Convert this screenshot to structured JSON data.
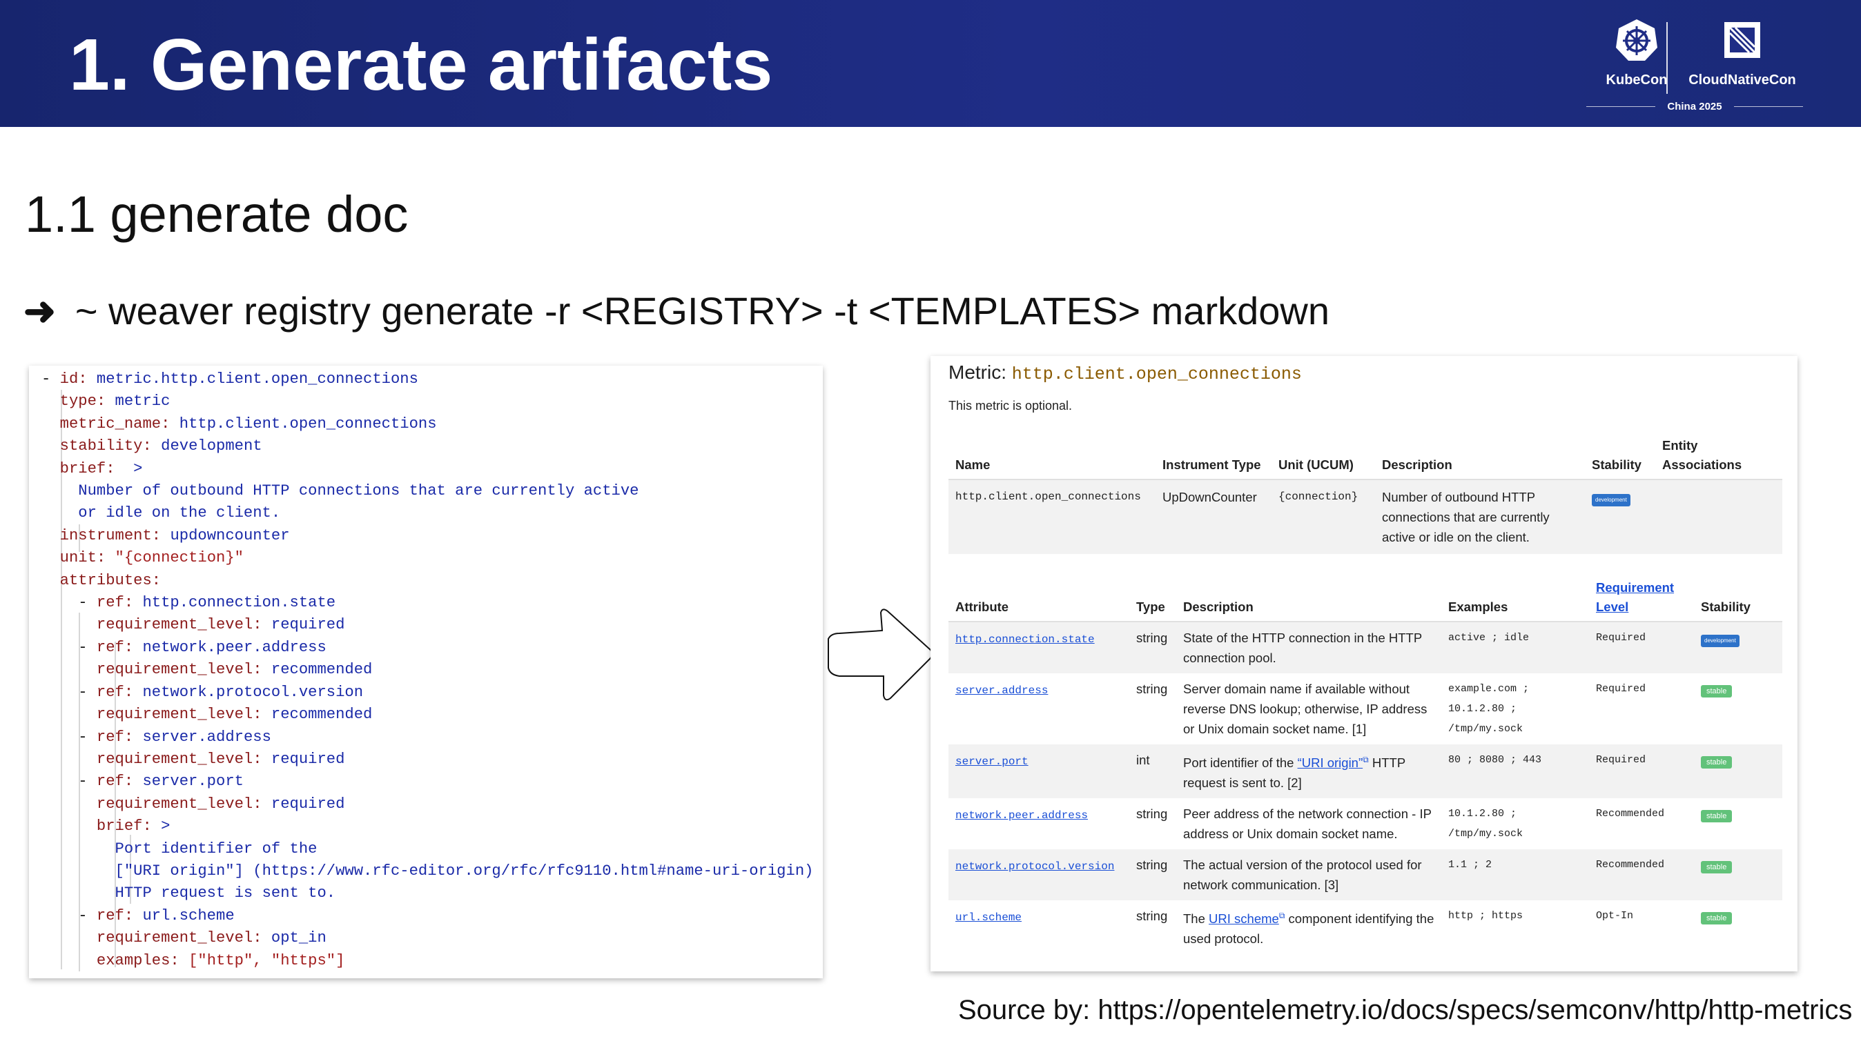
{
  "header": {
    "title": "1. Generate artifacts",
    "logo_kubecon": "KubeCon",
    "logo_cncf": "CloudNativeCon",
    "logo_event": "China 2025"
  },
  "subtitle": "1.1 generate doc",
  "command": {
    "arrow": "➜",
    "text": "~ weaver registry generate -r <REGISTRY> -t <TEMPLATES> markdown"
  },
  "yaml": {
    "lines": [
      {
        "indent": "- ",
        "key": "id",
        "value": "metric.http.client.open_connections",
        "vclass": "v"
      },
      {
        "indent": "  ",
        "key": "type",
        "value": "metric",
        "vclass": "v"
      },
      {
        "indent": "  ",
        "key": "metric_name",
        "value": "http.client.open_connections",
        "vclass": "v"
      },
      {
        "indent": "  ",
        "key": "stability",
        "value": "development",
        "vclass": "v"
      },
      {
        "indent": "  ",
        "key": "brief",
        "value": " >",
        "vclass": "v"
      },
      {
        "indent": "    ",
        "key": "",
        "value": "Number of outbound HTTP connections that are currently active",
        "vclass": "v"
      },
      {
        "indent": "    ",
        "key": "",
        "value": "or idle on the client.",
        "vclass": "v"
      },
      {
        "indent": "  ",
        "key": "instrument",
        "value": "updowncounter",
        "vclass": "v"
      },
      {
        "indent": "  ",
        "key": "unit",
        "value": "\"{connection}\"",
        "vclass": "s"
      },
      {
        "indent": "  ",
        "key": "attributes",
        "value": "",
        "vclass": "v"
      },
      {
        "indent": "    - ",
        "key": "ref",
        "value": "http.connection.state",
        "vclass": "v"
      },
      {
        "indent": "      ",
        "key": "requirement_level",
        "value": "required",
        "vclass": "v"
      },
      {
        "indent": "    - ",
        "key": "ref",
        "value": "network.peer.address",
        "vclass": "v"
      },
      {
        "indent": "      ",
        "key": "requirement_level",
        "value": "recommended",
        "vclass": "v"
      },
      {
        "indent": "    - ",
        "key": "ref",
        "value": "network.protocol.version",
        "vclass": "v"
      },
      {
        "indent": "      ",
        "key": "requirement_level",
        "value": "recommended",
        "vclass": "v"
      },
      {
        "indent": "    - ",
        "key": "ref",
        "value": "server.address",
        "vclass": "v"
      },
      {
        "indent": "      ",
        "key": "requirement_level",
        "value": "required",
        "vclass": "v"
      },
      {
        "indent": "    - ",
        "key": "ref",
        "value": "server.port",
        "vclass": "v"
      },
      {
        "indent": "      ",
        "key": "requirement_level",
        "value": "required",
        "vclass": "v"
      },
      {
        "indent": "      ",
        "key": "brief",
        "value": ">",
        "vclass": "v"
      },
      {
        "indent": "        ",
        "key": "",
        "value": "Port identifier of the",
        "vclass": "v"
      },
      {
        "indent": "        ",
        "key": "",
        "value": "[\"URI origin\"] (https://www.rfc-editor.org/rfc/rfc9110.html#name-uri-origin)",
        "vclass": "v"
      },
      {
        "indent": "        ",
        "key": "",
        "value": "HTTP request is sent to.",
        "vclass": "v"
      },
      {
        "indent": "    - ",
        "key": "ref",
        "value": "url.scheme",
        "vclass": "v"
      },
      {
        "indent": "      ",
        "key": "requirement_level",
        "value": "opt_in",
        "vclass": "v"
      },
      {
        "indent": "      ",
        "key": "examples",
        "value": "[\"http\", \"https\"]",
        "vclass": "s"
      }
    ]
  },
  "doc": {
    "metric_label": "Metric:",
    "metric_name": "http.client.open_connections",
    "optional_note": "This metric is optional.",
    "metric_table": {
      "headers": [
        "Name",
        "Instrument Type",
        "Unit (UCUM)",
        "Description",
        "Stability",
        "Entity Associations"
      ],
      "row": {
        "name": "http.client.open_connections",
        "type": "UpDownCounter",
        "unit": "{connection}",
        "description": "Number of outbound HTTP connections that are currently active or idle on the client.",
        "stability": "development",
        "entity": ""
      }
    },
    "attr_table": {
      "headers": [
        "Attribute",
        "Type",
        "Description",
        "Examples",
        "Requirement Level",
        "Stability"
      ],
      "rows": [
        {
          "attribute": "http.connection.state",
          "type": "string",
          "description": "State of the HTTP connection in the HTTP connection pool.",
          "desc_link": "",
          "desc_after": "",
          "examples": "active ; idle",
          "requirement": "Required",
          "stability": "development"
        },
        {
          "attribute": "server.address",
          "type": "string",
          "description": "Server domain name if available without reverse DNS lookup; otherwise, IP address or Unix domain socket name. [1]",
          "desc_link": "",
          "desc_after": "",
          "examples": "example.com ; 10.1.2.80 ; /tmp/my.sock",
          "requirement": "Required",
          "stability": "stable"
        },
        {
          "attribute": "server.port",
          "type": "int",
          "description": "Port identifier of the ",
          "desc_link": "“URI origin”",
          "desc_after": " HTTP request is sent to. [2]",
          "examples": "80 ; 8080 ; 443",
          "requirement": "Required",
          "stability": "stable"
        },
        {
          "attribute": "network.peer.address",
          "type": "string",
          "description": "Peer address of the network connection - IP address or Unix domain socket name.",
          "desc_link": "",
          "desc_after": "",
          "examples": "10.1.2.80 ; /tmp/my.sock",
          "requirement": "Recommended",
          "stability": "stable"
        },
        {
          "attribute": "network.protocol.version",
          "type": "string",
          "description": "The actual version of the protocol used for network communication. [3]",
          "desc_link": "",
          "desc_after": "",
          "examples": "1.1 ; 2",
          "requirement": "Recommended",
          "stability": "stable"
        },
        {
          "attribute": "url.scheme",
          "type": "string",
          "description": "The ",
          "desc_link": "URI scheme",
          "desc_after": " component identifying the used protocol.",
          "examples": "http ; https",
          "requirement": "Opt-In",
          "stability": "stable"
        }
      ]
    }
  },
  "source": "Source by: https://opentelemetry.io/docs/specs/semconv/http/http-metrics",
  "colors": {
    "header_bg": "#1f2d86",
    "yaml_key": "#8a1a1a",
    "yaml_value": "#1a2aa8",
    "link": "#1a4fd6",
    "badge_development": "#2d72c9",
    "badge_stable": "#62c27a"
  }
}
